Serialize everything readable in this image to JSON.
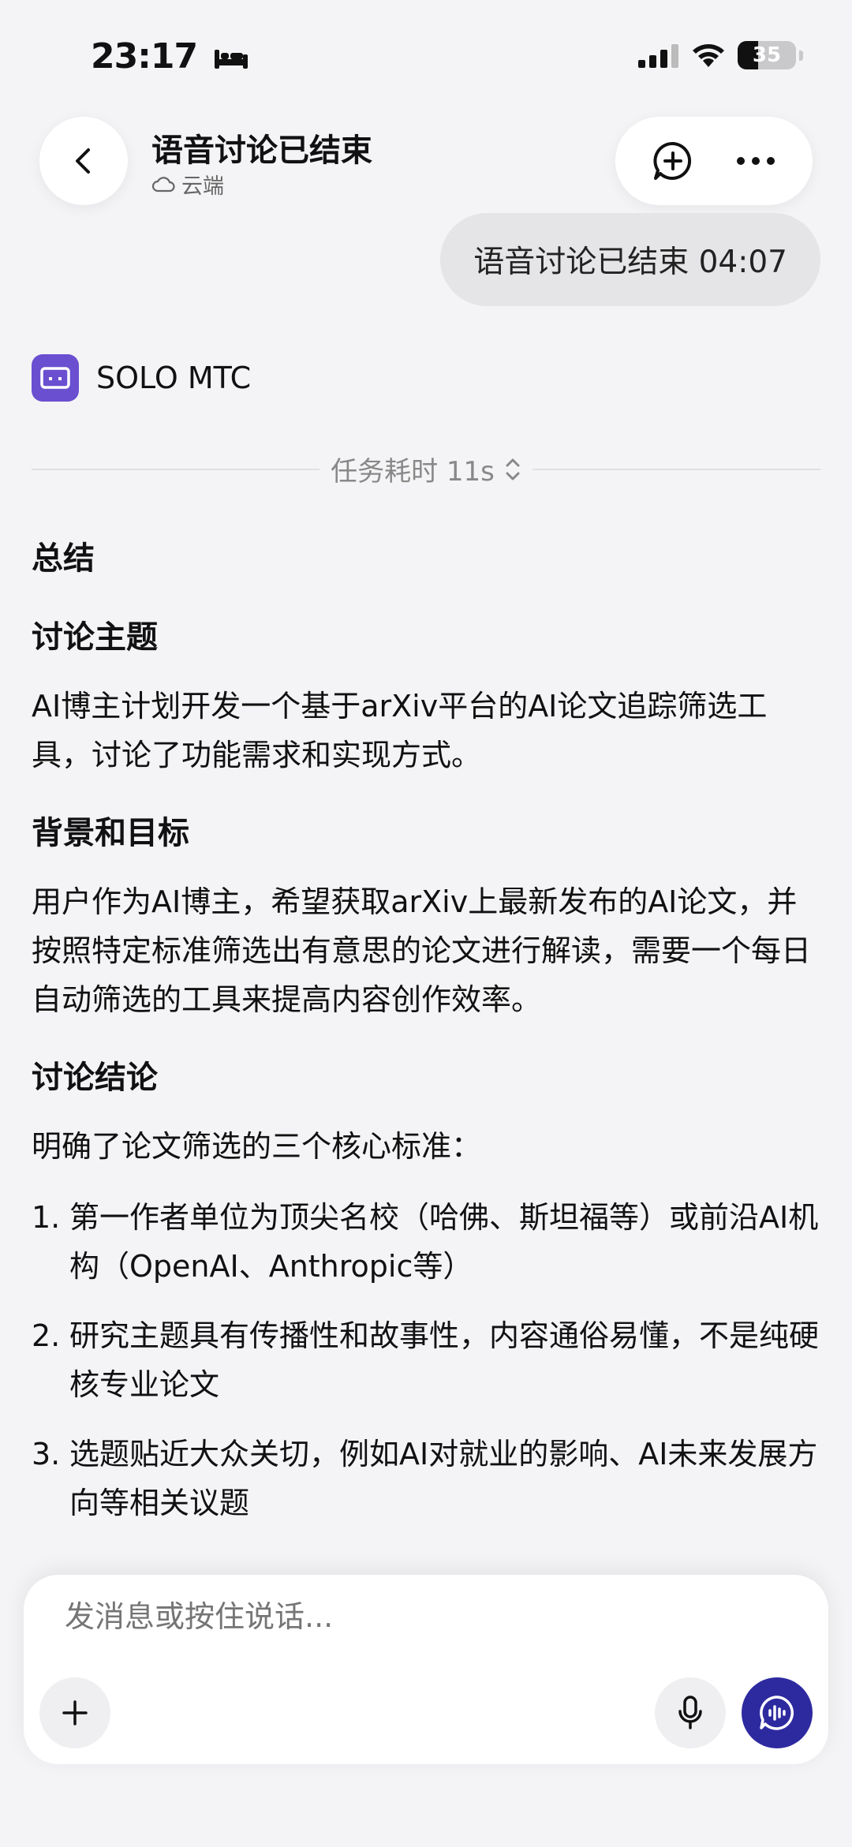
{
  "status": {
    "time": "23:17",
    "battery": "35",
    "battery_level": 0.35
  },
  "header": {
    "title": "语音讨论已结束",
    "subtitle": "云端"
  },
  "user_bubble": {
    "text": "语音讨论已结束 04:07"
  },
  "agent": {
    "name": "SOLO MTC",
    "task_time": "任务耗时 11s"
  },
  "summary": {
    "title": "总结",
    "sections": [
      {
        "heading": "讨论主题",
        "body": "AI博主计划开发一个基于arXiv平台的AI论文追踪筛选工具，讨论了功能需求和实现方式。"
      },
      {
        "heading": "背景和目标",
        "body": "用户作为AI博主，希望获取arXiv上最新发布的AI论文，并按照特定标准筛选出有意思的论文进行解读，需要一个每日自动筛选的工具来提高内容创作效率。"
      },
      {
        "heading": "讨论结论",
        "body": "明确了论文筛选的三个核心标准："
      }
    ],
    "criteria": [
      {
        "num": "1.",
        "text": "第一作者单位为顶尖名校（哈佛、斯坦福等）或前沿AI机构（OpenAI、Anthropic等）"
      },
      {
        "num": "2.",
        "text": "研究主题具有传播性和故事性，内容通俗易懂，不是纯硬核专业论文"
      },
      {
        "num": "3.",
        "text": "选题贴近大众关切，例如AI对就业的影响、AI未来发展方向等相关议题"
      }
    ]
  },
  "composer": {
    "placeholder": "发消息或按住说话..."
  },
  "colors": {
    "accent": "#6a4fd0",
    "voice_button": "#2d2aa0",
    "background": "#f4f4f6"
  }
}
